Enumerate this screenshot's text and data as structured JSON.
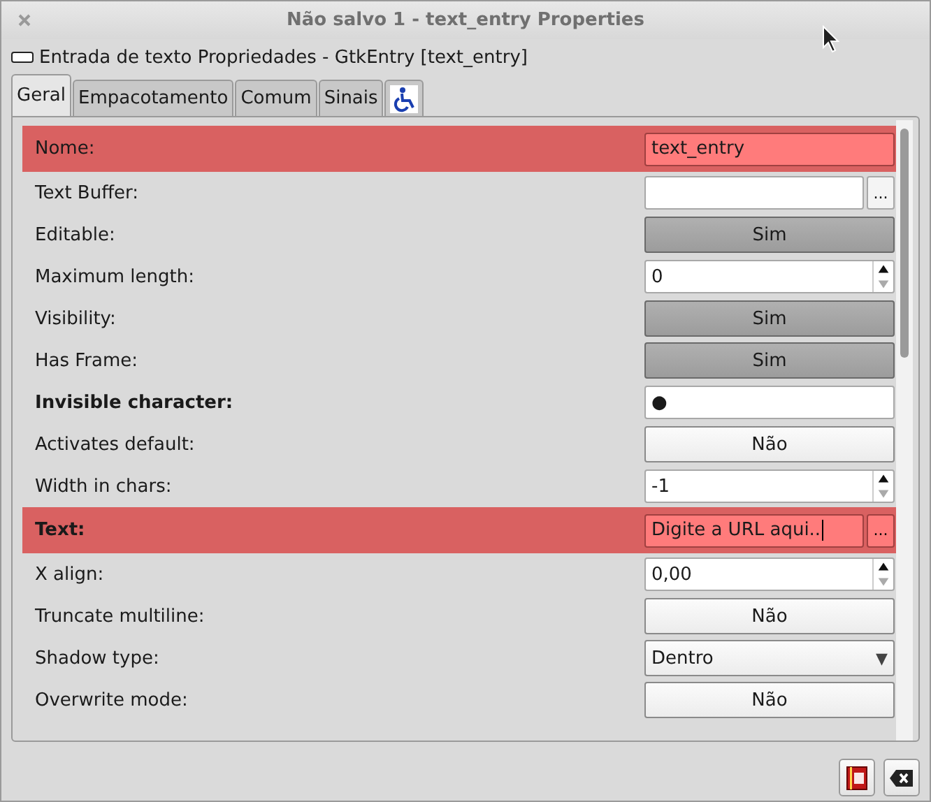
{
  "window": {
    "title": "Não salvo 1 - text_entry Properties"
  },
  "header": {
    "text": "Entrada de texto Propriedades - GtkEntry [text_entry]"
  },
  "tabs": [
    {
      "kind": "text",
      "label": "Geral",
      "selected": true
    },
    {
      "kind": "text",
      "label": "Empacotamento",
      "selected": false
    },
    {
      "kind": "text",
      "label": "Comum",
      "selected": false
    },
    {
      "kind": "text",
      "label": "Sinais",
      "selected": false
    },
    {
      "kind": "accessibility",
      "selected": false
    }
  ],
  "properties": [
    {
      "label": "Nome:",
      "bold": false,
      "highlighted": true,
      "kind": "entry",
      "value": "text_entry"
    },
    {
      "label": "Text Buffer:",
      "bold": false,
      "highlighted": false,
      "kind": "entry_more",
      "more": "..."
    },
    {
      "label": "Editable:",
      "bold": false,
      "highlighted": false,
      "kind": "toggle",
      "value": "Sim",
      "on": true
    },
    {
      "label": "Maximum length:",
      "bold": false,
      "highlighted": false,
      "kind": "spin",
      "value": "0"
    },
    {
      "label": "Visibility:",
      "bold": false,
      "highlighted": false,
      "kind": "toggle",
      "value": "Sim",
      "on": true
    },
    {
      "label": "Has Frame:",
      "bold": false,
      "highlighted": false,
      "kind": "toggle",
      "value": "Sim",
      "on": true
    },
    {
      "label": "Invisible character:",
      "bold": true,
      "highlighted": false,
      "kind": "entry",
      "value": "●"
    },
    {
      "label": "Activates default:",
      "bold": false,
      "highlighted": false,
      "kind": "toggle",
      "value": "Não",
      "on": false
    },
    {
      "label": "Width in chars:",
      "bold": false,
      "highlighted": false,
      "kind": "spin",
      "value": "-1"
    },
    {
      "label": "Text:",
      "bold": true,
      "highlighted": true,
      "kind": "entry_more",
      "value": "Digite a URL aqui..",
      "more": "..."
    },
    {
      "label": "X align:",
      "bold": false,
      "highlighted": false,
      "kind": "spin",
      "value": "0,00"
    },
    {
      "label": "Truncate multiline:",
      "bold": false,
      "highlighted": false,
      "kind": "toggle",
      "value": "Não",
      "on": false
    },
    {
      "label": "Shadow type:",
      "bold": false,
      "highlighted": false,
      "kind": "combo",
      "value": "Dentro",
      "arrow": "▼"
    },
    {
      "label": "Overwrite mode:",
      "bold": false,
      "highlighted": false,
      "kind": "toggle",
      "value": "Não",
      "on": false
    }
  ]
}
